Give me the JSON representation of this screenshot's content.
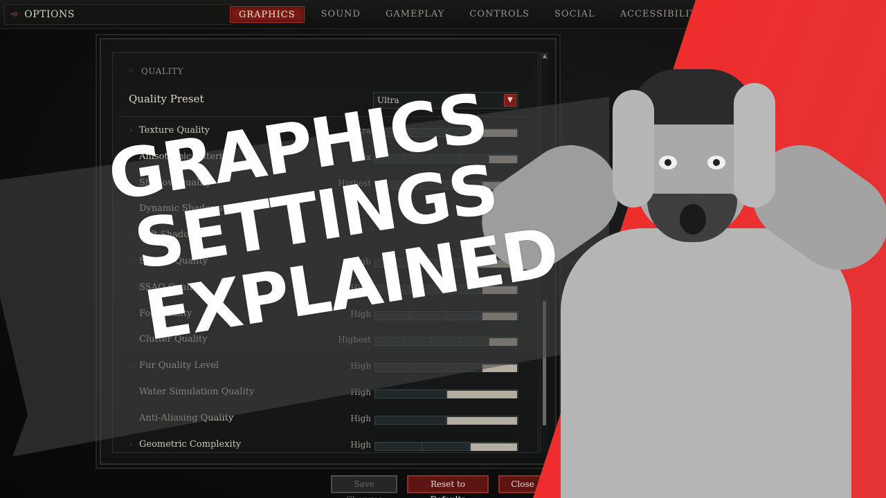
{
  "topbar": {
    "title": "OPTIONS",
    "title_icon": "arrow-right-icon",
    "tabs": [
      {
        "label": "GRAPHICS",
        "active": true
      },
      {
        "label": "SOUND",
        "active": false
      },
      {
        "label": "GAMEPLAY",
        "active": false
      },
      {
        "label": "CONTROLS",
        "active": false
      },
      {
        "label": "SOCIAL",
        "active": false
      },
      {
        "label": "ACCESSIBILITY",
        "active": false
      }
    ]
  },
  "panel": {
    "section": "QUALITY",
    "preset": {
      "label": "Quality Preset",
      "value": "Ultra"
    },
    "settings": [
      {
        "label": "Texture Quality",
        "value": "Ultra",
        "type": "bar",
        "level": 4,
        "steps": 4
      },
      {
        "label": "Anisotropic Filtering",
        "value": "16x",
        "type": "bar",
        "level": 5,
        "steps": 5
      },
      {
        "label": "Shadow Quality",
        "value": "Highest",
        "type": "bar",
        "level": 4,
        "steps": 4
      },
      {
        "label": "Dynamic Shadows",
        "value": "",
        "type": "checkbox",
        "checked": true
      },
      {
        "label": "Soft Shadows",
        "value": "",
        "type": "none"
      },
      {
        "label": "Shader Quality",
        "value": "High",
        "type": "bar",
        "level": 3,
        "steps": 3
      },
      {
        "label": "SSAO Quality",
        "value": "High",
        "type": "bar",
        "level": 4,
        "steps": 4
      },
      {
        "label": "Fog Quality",
        "value": "High",
        "type": "bar",
        "level": 4,
        "steps": 4
      },
      {
        "label": "Clutter Quality",
        "value": "Highest",
        "type": "bar",
        "level": 5,
        "steps": 5
      },
      {
        "label": "Fur Quality Level",
        "value": "High",
        "type": "bar",
        "level": 4,
        "steps": 4
      },
      {
        "label": "Water Simulation Quality",
        "value": "High",
        "type": "bar",
        "level": 2,
        "steps": 2
      },
      {
        "label": "Anti-Aliasing Quality",
        "value": "High",
        "type": "bar",
        "level": 2,
        "steps": 2
      },
      {
        "label": "Geometric Complexity",
        "value": "High",
        "type": "bar",
        "level": 3,
        "steps": 3
      }
    ]
  },
  "footer": {
    "save": "Save Changes",
    "reset": "Reset to Defaults",
    "close": "Close"
  },
  "thumbnail": {
    "headline": [
      "GRAPHICS",
      "SETTINGS",
      "EXPLAINED"
    ],
    "accent_color": "#ff1b1b"
  }
}
